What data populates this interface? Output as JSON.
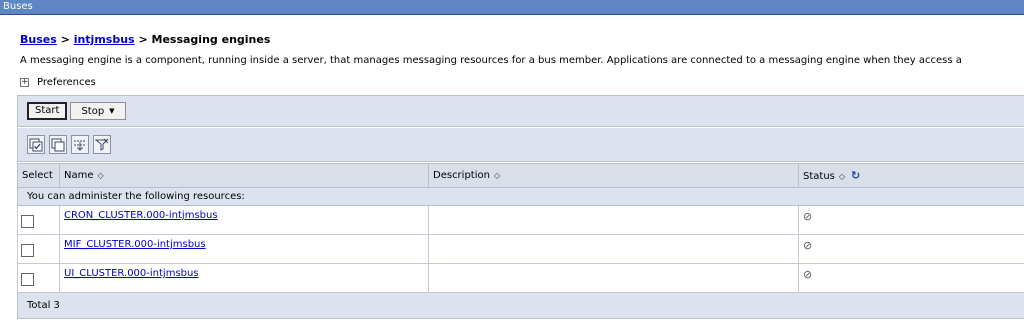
{
  "window": {
    "title": "Buses"
  },
  "breadcrumb": {
    "items": [
      "Buses",
      "intjmsbus",
      "Messaging engines"
    ],
    "separator": ">"
  },
  "description": "A messaging engine is a component, running inside a server, that manages messaging resources for a bus member. Applications are connected to a messaging engine when they access a",
  "preferences": {
    "label": "Preferences",
    "expander": "+"
  },
  "toolbar": {
    "start_label": "Start",
    "stop_label": "Stop",
    "stop_caret": "▼"
  },
  "icon_toolbar": [
    "select-all-icon",
    "deselect-all-icon",
    "expand-filter-icon",
    "clear-filter-icon"
  ],
  "table": {
    "columns": {
      "select": "Select",
      "name": "Name",
      "description": "Description",
      "status": "Status"
    },
    "admin_note": "You can administer the following resources:",
    "rows": [
      {
        "name": "CRON_CLUSTER.000-intjmsbus",
        "description": "",
        "status_icon": "stopped-icon"
      },
      {
        "name": "MIF_CLUSTER.000-intjmsbus",
        "description": "",
        "status_icon": "stopped-icon"
      },
      {
        "name": "UI_CLUSTER.000-intjmsbus",
        "description": "",
        "status_icon": "stopped-icon"
      }
    ],
    "total": "Total 3"
  },
  "colors": {
    "titlebar": "#5f86c4",
    "link": "#0000cc",
    "panel": "#dde3ee",
    "header": "#d8dfe9"
  }
}
